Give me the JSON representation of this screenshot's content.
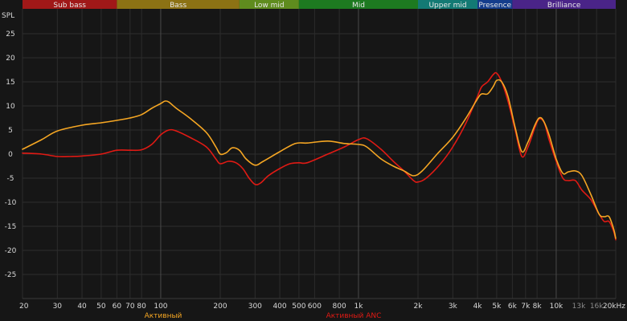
{
  "chart_data": {
    "type": "line",
    "title": "",
    "ylabel": "SPL",
    "xlabel": "",
    "x_scale": "log",
    "xlim": [
      20,
      20000
    ],
    "ylim": [
      -30,
      30
    ],
    "grid": true,
    "y_ticks": [
      25,
      20,
      15,
      10,
      5,
      0,
      -5,
      -10,
      -15,
      -20,
      -25
    ],
    "x_ticks": [
      {
        "f": 20,
        "label": "20",
        "dim": false
      },
      {
        "f": 30,
        "label": "30",
        "dim": false
      },
      {
        "f": 40,
        "label": "40",
        "dim": false
      },
      {
        "f": 50,
        "label": "50",
        "dim": false
      },
      {
        "f": 60,
        "label": "60",
        "dim": false
      },
      {
        "f": 70,
        "label": "70",
        "dim": false
      },
      {
        "f": 80,
        "label": "80",
        "dim": false
      },
      {
        "f": 100,
        "label": "100",
        "dim": false
      },
      {
        "f": 200,
        "label": "200",
        "dim": false
      },
      {
        "f": 300,
        "label": "300",
        "dim": false
      },
      {
        "f": 400,
        "label": "400",
        "dim": false
      },
      {
        "f": 500,
        "label": "500",
        "dim": false
      },
      {
        "f": 600,
        "label": "600",
        "dim": false
      },
      {
        "f": 800,
        "label": "800",
        "dim": false
      },
      {
        "f": 1000,
        "label": "1k",
        "dim": false
      },
      {
        "f": 2000,
        "label": "2k",
        "dim": false
      },
      {
        "f": 3000,
        "label": "3k",
        "dim": false
      },
      {
        "f": 4000,
        "label": "4k",
        "dim": false
      },
      {
        "f": 5000,
        "label": "5k",
        "dim": false
      },
      {
        "f": 6000,
        "label": "6k",
        "dim": false
      },
      {
        "f": 7000,
        "label": "7k",
        "dim": false
      },
      {
        "f": 8000,
        "label": "8k",
        "dim": false
      },
      {
        "f": 10000,
        "label": "10k",
        "dim": false
      },
      {
        "f": 13000,
        "label": "13k",
        "dim": true
      },
      {
        "f": 16000,
        "label": "16k",
        "dim": true
      },
      {
        "f": 20000,
        "label": "20kHz",
        "dim": false
      }
    ],
    "bands": [
      {
        "name": "Sub bass",
        "from": 20,
        "to": 60,
        "color": "#a01818"
      },
      {
        "name": "Bass",
        "from": 60,
        "to": 250,
        "color": "#8c7214"
      },
      {
        "name": "Low mid",
        "from": 250,
        "to": 500,
        "color": "#5f8c1e"
      },
      {
        "name": "Mid",
        "from": 500,
        "to": 2000,
        "color": "#1d7a20"
      },
      {
        "name": "Upper mid",
        "from": 2000,
        "to": 4000,
        "color": "#137a74"
      },
      {
        "name": "Presence",
        "from": 4000,
        "to": 6000,
        "color": "#143d8c"
      },
      {
        "name": "Brilliance",
        "from": 6000,
        "to": 20000,
        "color": "#4a2488"
      }
    ],
    "series": [
      {
        "name": "Активный",
        "color": "#f5a623",
        "points": [
          [
            20,
            1
          ],
          [
            25,
            3
          ],
          [
            30,
            4.8
          ],
          [
            40,
            6
          ],
          [
            50,
            6.5
          ],
          [
            60,
            7
          ],
          [
            70,
            7.5
          ],
          [
            80,
            8.2
          ],
          [
            90,
            9.5
          ],
          [
            100,
            10.5
          ],
          [
            105,
            11
          ],
          [
            110,
            10.8
          ],
          [
            120,
            9.5
          ],
          [
            140,
            7.5
          ],
          [
            170,
            4.5
          ],
          [
            190,
            1.5
          ],
          [
            200,
            0
          ],
          [
            215,
            0.3
          ],
          [
            230,
            1.3
          ],
          [
            250,
            0.8
          ],
          [
            270,
            -1
          ],
          [
            300,
            -2.3
          ],
          [
            330,
            -1.5
          ],
          [
            400,
            0.5
          ],
          [
            480,
            2.2
          ],
          [
            550,
            2.3
          ],
          [
            700,
            2.7
          ],
          [
            850,
            2.2
          ],
          [
            1000,
            2
          ],
          [
            1100,
            1.5
          ],
          [
            1300,
            -1
          ],
          [
            1500,
            -2.5
          ],
          [
            1700,
            -3.5
          ],
          [
            1900,
            -4.5
          ],
          [
            2100,
            -3.5
          ],
          [
            2500,
            0
          ],
          [
            3000,
            3.5
          ],
          [
            3500,
            7.5
          ],
          [
            4000,
            11.5
          ],
          [
            4200,
            12.5
          ],
          [
            4500,
            12.5
          ],
          [
            4800,
            14
          ],
          [
            5000,
            15.3
          ],
          [
            5300,
            15
          ],
          [
            5700,
            12
          ],
          [
            6200,
            5.5
          ],
          [
            6700,
            0.5
          ],
          [
            7200,
            2.5
          ],
          [
            7800,
            6
          ],
          [
            8200,
            7.5
          ],
          [
            8600,
            7
          ],
          [
            9200,
            4
          ],
          [
            10000,
            -1
          ],
          [
            10800,
            -4
          ],
          [
            11500,
            -3.7
          ],
          [
            12500,
            -3.5
          ],
          [
            13500,
            -4.5
          ],
          [
            15000,
            -8.5
          ],
          [
            16500,
            -12.5
          ],
          [
            17500,
            -13
          ],
          [
            18500,
            -13
          ],
          [
            19500,
            -15.5
          ],
          [
            20000,
            -17.5
          ]
        ]
      },
      {
        "name": "Активный ANC",
        "color": "#e01a14",
        "points": [
          [
            20,
            0.2
          ],
          [
            25,
            0
          ],
          [
            30,
            -0.5
          ],
          [
            35,
            -0.5
          ],
          [
            40,
            -0.4
          ],
          [
            50,
            0
          ],
          [
            60,
            0.8
          ],
          [
            70,
            0.8
          ],
          [
            80,
            0.9
          ],
          [
            90,
            2
          ],
          [
            100,
            4
          ],
          [
            110,
            5
          ],
          [
            120,
            4.8
          ],
          [
            140,
            3.5
          ],
          [
            170,
            1.5
          ],
          [
            190,
            -1
          ],
          [
            200,
            -2
          ],
          [
            220,
            -1.5
          ],
          [
            240,
            -1.8
          ],
          [
            260,
            -3
          ],
          [
            280,
            -5
          ],
          [
            300,
            -6.3
          ],
          [
            320,
            -6
          ],
          [
            350,
            -4.5
          ],
          [
            400,
            -3
          ],
          [
            450,
            -2
          ],
          [
            500,
            -1.8
          ],
          [
            550,
            -1.8
          ],
          [
            700,
            0
          ],
          [
            850,
            1.5
          ],
          [
            1000,
            3
          ],
          [
            1100,
            3.2
          ],
          [
            1300,
            1
          ],
          [
            1500,
            -1.5
          ],
          [
            1700,
            -3.5
          ],
          [
            1900,
            -5.5
          ],
          [
            2000,
            -5.8
          ],
          [
            2200,
            -5
          ],
          [
            2600,
            -2
          ],
          [
            3000,
            1.5
          ],
          [
            3500,
            6.5
          ],
          [
            4000,
            12
          ],
          [
            4200,
            14
          ],
          [
            4500,
            15
          ],
          [
            4800,
            16.5
          ],
          [
            5000,
            16.8
          ],
          [
            5300,
            15
          ],
          [
            5700,
            11
          ],
          [
            6200,
            5
          ],
          [
            6700,
            -0.5
          ],
          [
            7200,
            1.5
          ],
          [
            7800,
            5.5
          ],
          [
            8200,
            7.3
          ],
          [
            8700,
            6.5
          ],
          [
            9200,
            3
          ],
          [
            10000,
            -1.5
          ],
          [
            10800,
            -5
          ],
          [
            11500,
            -5.5
          ],
          [
            12500,
            -5.5
          ],
          [
            13500,
            -7.5
          ],
          [
            15000,
            -9.5
          ],
          [
            16500,
            -12.5
          ],
          [
            17500,
            -14
          ],
          [
            18500,
            -14
          ],
          [
            19500,
            -16
          ],
          [
            20000,
            -17.8
          ]
        ]
      }
    ]
  }
}
